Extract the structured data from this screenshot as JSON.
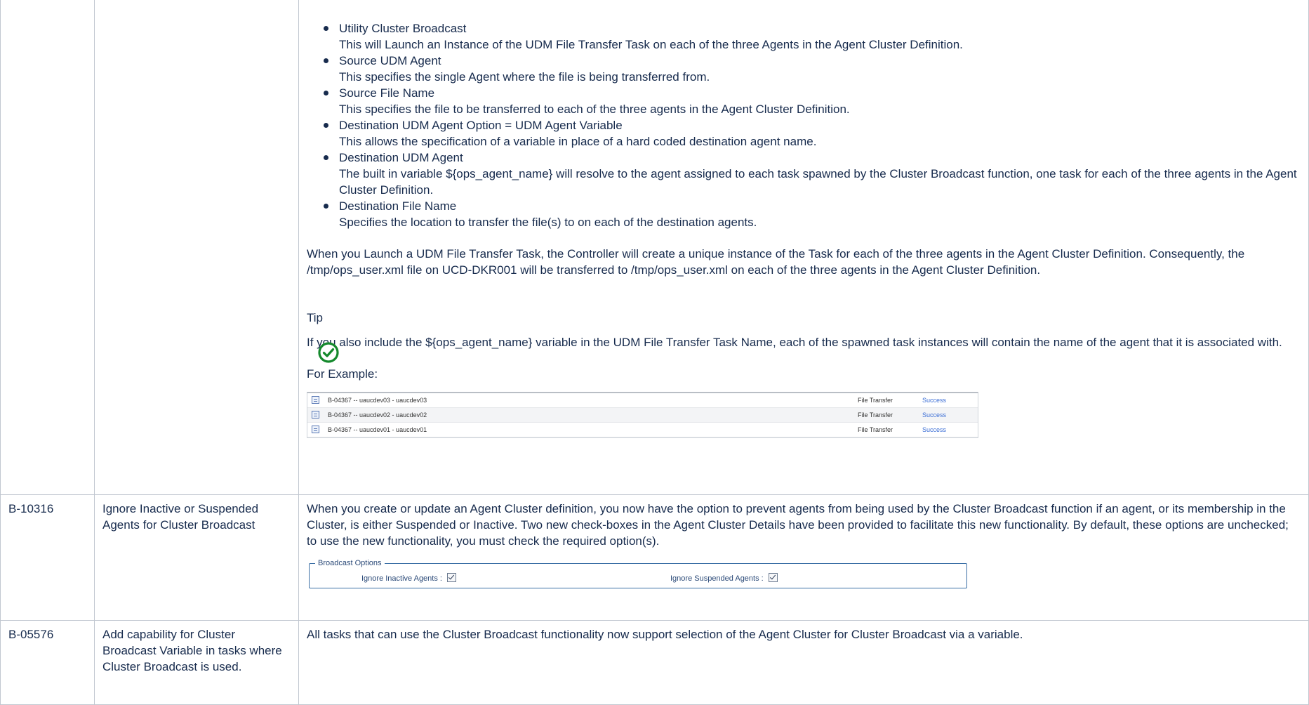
{
  "row_continuation": {
    "fields": [
      {
        "label": "Utility Cluster Broadcast",
        "desc": "This will Launch an Instance of the UDM File Transfer Task on each of the three Agents in the Agent Cluster Definition."
      },
      {
        "label": "Source UDM Agent",
        "desc": "This specifies the single Agent where the file is being transferred from."
      },
      {
        "label": "Source File Name",
        "desc": "This specifies the file to be transferred to each of the three agents in the Agent Cluster Definition."
      },
      {
        "label": "Destination UDM Agent Option = UDM Agent Variable",
        "desc": "This allows the specification of a variable in place of a hard coded destination agent name."
      },
      {
        "label": "Destination UDM Agent",
        "desc": "The built in variable ${ops_agent_name} will resolve to the agent assigned to each task spawned by the Cluster Broadcast function, one task for each of the three agents in the Agent Cluster Definition."
      },
      {
        "label": "Destination File Name",
        "desc": "Specifies the location to transfer the file(s) to on each of the destination agents."
      }
    ],
    "launch_paragraph": "When you Launch a UDM File Transfer Task, the Controller will create a unique instance of the Task for each of the three agents in the Agent Cluster Definition. Consequently, the /tmp/ops_user.xml file on UCD-DKR001 will be transferred to /tmp/ops_user.xml on each of the three agents in the Agent Cluster Definition.",
    "tip": {
      "title": "Tip",
      "icon": "check-circle-icon",
      "text": "If you also include the ${ops_agent_name} variable in the UDM File Transfer Task Name, each of the spawned task instances will contain the name of the agent that it is associated with."
    },
    "example_label": "For Example:",
    "example_rows": [
      {
        "name": "B-04367 -- uaucdev03 - uaucdev03",
        "type": "File Transfer",
        "status": "Success"
      },
      {
        "name": "B-04367 -- uaucdev02 - uaucdev02",
        "type": "File Transfer",
        "status": "Success"
      },
      {
        "name": "B-04367 -- uaucdev01 - uaucdev01",
        "type": "File Transfer",
        "status": "Success"
      }
    ]
  },
  "row_b10316": {
    "id": "B-10316",
    "title": "Ignore Inactive or Suspended Agents for Cluster Broadcast",
    "description": "When you create or update an Agent Cluster definition, you now have the option to prevent agents from being used by the Cluster Broadcast function if an agent, or its membership in the Cluster, is either Suspended or Inactive. Two new check-boxes in the Agent Cluster Details have been provided to facilitate this new functionality. By default, these options are unchecked; to use the new functionality, you must check the required option(s).",
    "broadcast_options": {
      "legend": "Broadcast Options",
      "inactive_label": "Ignore Inactive Agents :",
      "inactive_checked": true,
      "suspended_label": "Ignore Suspended Agents :",
      "suspended_checked": true
    }
  },
  "row_b05576": {
    "id": "B-05576",
    "title": "Add capability for Cluster Broadcast Variable in tasks where Cluster Broadcast is used.",
    "description": "All tasks that can use the Cluster Broadcast functionality now support selection of the Agent Cluster for Cluster Broadcast via a variable."
  },
  "colors": {
    "text": "#172b4d",
    "border": "#c1c7d0",
    "tip_green": "#14892c",
    "link_blue": "#3c6fd6"
  }
}
